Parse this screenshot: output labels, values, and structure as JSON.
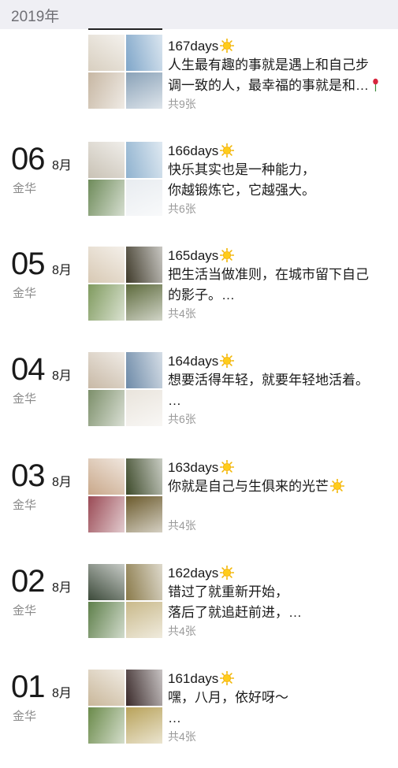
{
  "header": {
    "year": "2019年"
  },
  "entries": [
    {
      "day": "",
      "month": "",
      "location": "",
      "title": "167days",
      "lines": [
        "人生最有趣的事就是遇上和自己步",
        "调一致的人，最幸福的事就是和…"
      ],
      "count": "共9张",
      "emoji": "sun-icon",
      "trailing_icon": "rose-icon",
      "tiles": [
        "#d8cfc0",
        "#7fa6c9",
        "#c7b7a3",
        "#8aa2b8"
      ]
    },
    {
      "day": "06",
      "month": "8月",
      "location": "金华",
      "title": "166days",
      "lines": [
        "快乐其实也是一种能力，",
        "你越锻炼它，它越强大。"
      ],
      "count": "共6张",
      "emoji": "sun-icon",
      "tiles": [
        "#c9c2b5",
        "#8fb2cf",
        "#6e8b5a",
        "#e8ecf0"
      ]
    },
    {
      "day": "05",
      "month": "8月",
      "location": "金华",
      "title": "165days",
      "lines": [
        "把生活当做准则，在城市留下自己",
        "的影子。…"
      ],
      "count": "共4张",
      "emoji": "sun-icon",
      "tiles": [
        "#d8c9b4",
        "#3f3a2a",
        "#7f9a5e",
        "#5d6a3c"
      ]
    },
    {
      "day": "04",
      "month": "8月",
      "location": "金华",
      "title": "164days",
      "lines": [
        "想要活得年轻，就要年轻地活着。",
        "…"
      ],
      "count": "共6张",
      "emoji": "sun-icon",
      "tiles": [
        "#c8b9a6",
        "#6d8aa8",
        "#7c8f6a",
        "#e9e4dc"
      ]
    },
    {
      "day": "03",
      "month": "8月",
      "location": "金华",
      "title": "163days",
      "lines": [
        "你就是自己与生俱来的光芒"
      ],
      "count": "共4张",
      "emoji": "sun-icon",
      "inline_emoji": "sun-icon",
      "tiles": [
        "#c9a88a",
        "#3d4a2a",
        "#9a4a55",
        "#6b5a2c"
      ]
    },
    {
      "day": "02",
      "month": "8月",
      "location": "金华",
      "title": "162days",
      "lines": [
        "错过了就重新开始，",
        "落后了就追赶前进，…"
      ],
      "count": "共4张",
      "emoji": "sun-icon",
      "tiles": [
        "#3c4a3a",
        "#8a7a4a",
        "#5e7f4a",
        "#c9b98a"
      ]
    },
    {
      "day": "01",
      "month": "8月",
      "location": "金华",
      "title": "161days",
      "lines": [
        "嘿，八月，依好呀～",
        "…"
      ],
      "count": "共4张",
      "emoji": "sun-icon",
      "tiles": [
        "#c9b79a",
        "#3a2a2a",
        "#6a8a4a",
        "#b8a25a"
      ]
    }
  ]
}
